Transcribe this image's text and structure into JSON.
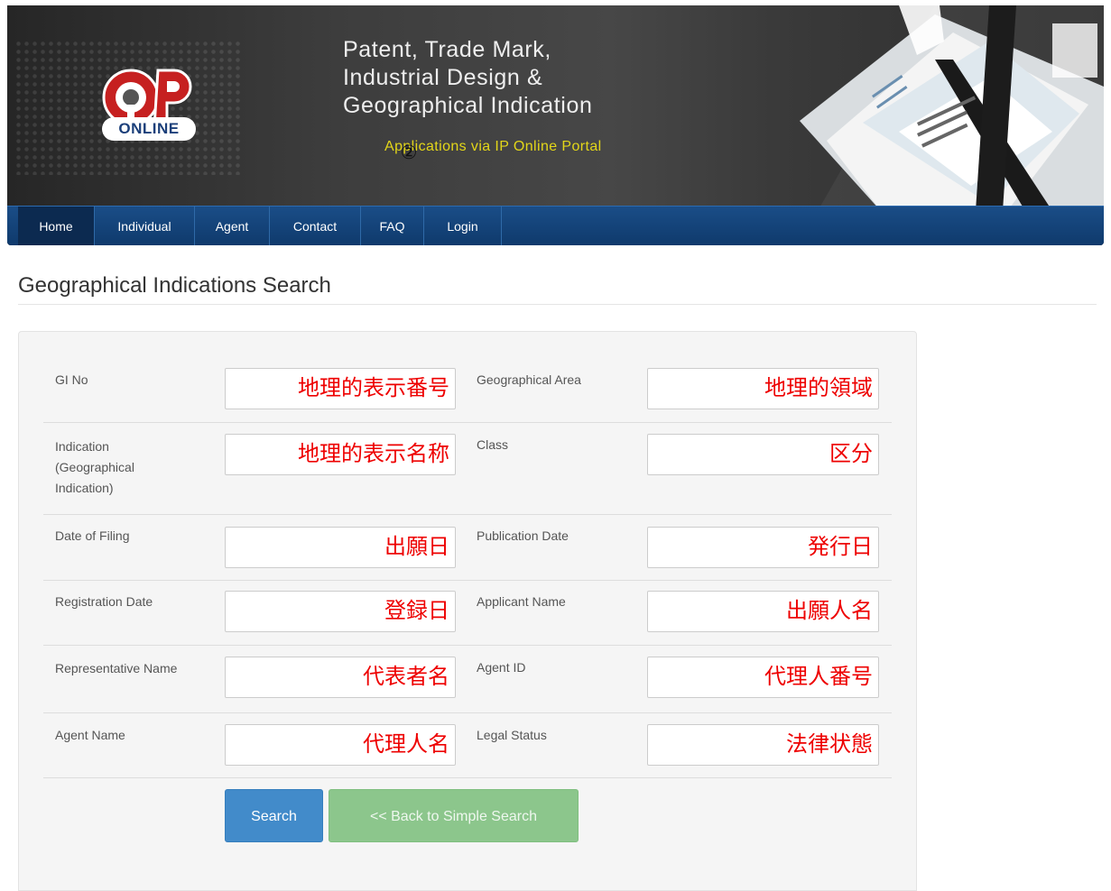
{
  "header": {
    "logo_text": "ONLINE",
    "tagline": [
      "Patent, Trade Mark,",
      "Industrial Design &",
      "Geographical Indication"
    ],
    "subtagline": "Applications via IP Online Portal",
    "overlay_mark": "②"
  },
  "nav": [
    {
      "label": "Home"
    },
    {
      "label": "Individual"
    },
    {
      "label": "Agent"
    },
    {
      "label": "Contact"
    },
    {
      "label": "FAQ"
    },
    {
      "label": "Login"
    }
  ],
  "page": {
    "title": "Geographical Indications Search"
  },
  "form": {
    "fields": [
      {
        "label": "GI No",
        "value": "地理的表示番号"
      },
      {
        "label": "Geographical Area",
        "value": "地理的領域"
      },
      {
        "label": "Indication (Geographical Indication)",
        "value": "地理的表示名称"
      },
      {
        "label": "Class",
        "value": "区分"
      },
      {
        "label": "Date of Filing",
        "value": "出願日"
      },
      {
        "label": "Publication Date",
        "value": "発行日"
      },
      {
        "label": "Registration Date",
        "value": "登録日"
      },
      {
        "label": "Applicant Name",
        "value": "出願人名"
      },
      {
        "label": "Representative Name",
        "value": "代表者名"
      },
      {
        "label": "Agent ID",
        "value": "代理人番号"
      },
      {
        "label": "Agent Name",
        "value": "代理人名"
      },
      {
        "label": "Legal Status",
        "value": "法律状態"
      }
    ],
    "search_label": "Search",
    "back_label": "<< Back to Simple Search"
  },
  "colors": {
    "nav_bg": "#12447b",
    "nav_active": "#0c2a50",
    "field_text": "#ee0000",
    "search_button": "#428bca",
    "back_button": "#8cc68c",
    "subtagline": "#e3d619"
  }
}
